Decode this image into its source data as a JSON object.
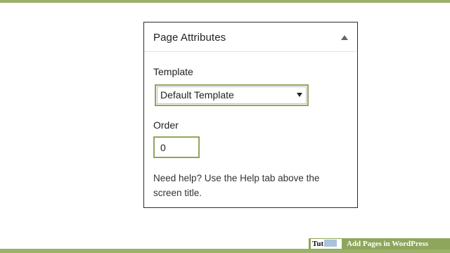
{
  "metabox": {
    "title": "Page Attributes",
    "toggle_icon": "triangle-up-icon"
  },
  "template_field": {
    "label": "Template",
    "selected_value": "Default Template",
    "caret_icon": "triangle-down-icon"
  },
  "order_field": {
    "label": "Order",
    "value": "0"
  },
  "help": {
    "text": "Need help? Use the Help tab above the screen title."
  },
  "watermark": {
    "logo_text": "Tut",
    "caption": "Add Pages in WordPress"
  },
  "colors": {
    "accent_green": "#8ea65b",
    "bar_green": "#9bb068",
    "border_dark": "#2b2b2b"
  }
}
